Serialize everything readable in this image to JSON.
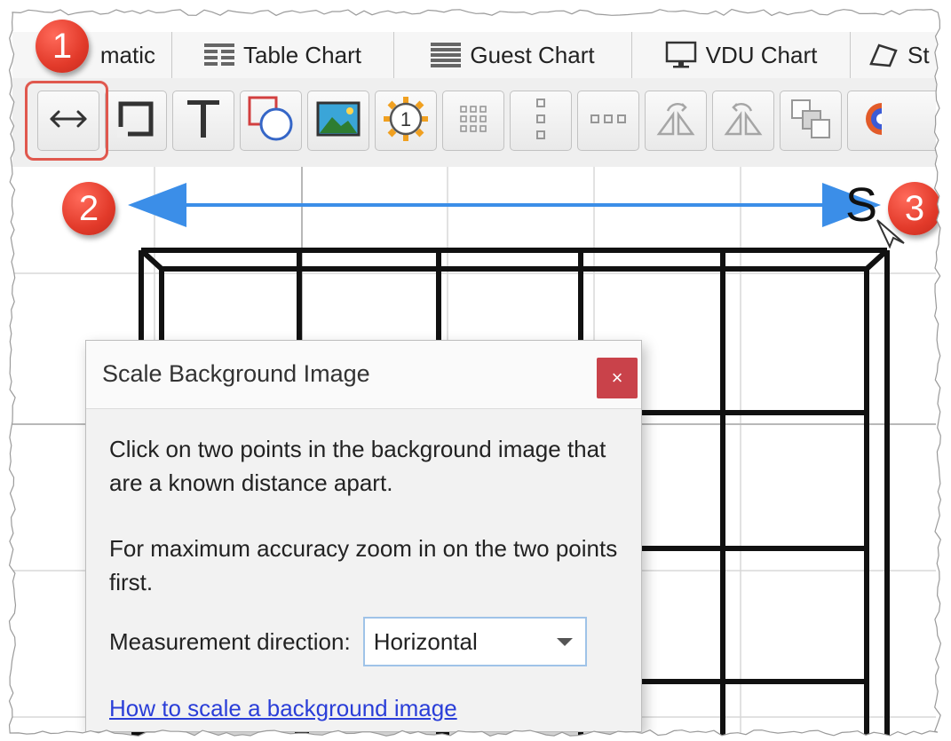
{
  "tabs": [
    {
      "label": "matic",
      "icon": "schematic-icon"
    },
    {
      "label": "Table Chart",
      "icon": "table-grid-icon"
    },
    {
      "label": "Guest Chart",
      "icon": "guest-list-icon"
    },
    {
      "label": "VDU Chart",
      "icon": "monitor-icon"
    },
    {
      "label": "St",
      "icon": "tag-icon"
    }
  ],
  "toolbar": {
    "buttons": [
      "scale-arrow-icon",
      "rectangle-icon",
      "text-icon",
      "shapes-icon",
      "image-icon",
      "numbered-gear-icon",
      "grid-dots-icon",
      "vertical-dots-icon",
      "horizontal-dots-icon",
      "rotate-icon",
      "flip-icon",
      "arrange-icon",
      "color-wheel-icon"
    ],
    "highlight_color": "#e0584e"
  },
  "callouts": [
    "1",
    "2",
    "3"
  ],
  "canvas": {
    "marker_text": "S",
    "arrow_color": "#3b8ee8"
  },
  "dialog": {
    "title": "Scale Background Image",
    "close_label": "×",
    "paragraph1": "Click on two points in the background image that are a known distance apart.",
    "paragraph2": "For maximum accuracy zoom in on the two points first.",
    "measurement_label": "Measurement direction:",
    "measurement_value": "Horizontal",
    "help_link": "How to scale a background image"
  },
  "colors": {
    "callout": "#e23a2a",
    "close_button": "#c9424a",
    "link": "#2a3ed8"
  }
}
